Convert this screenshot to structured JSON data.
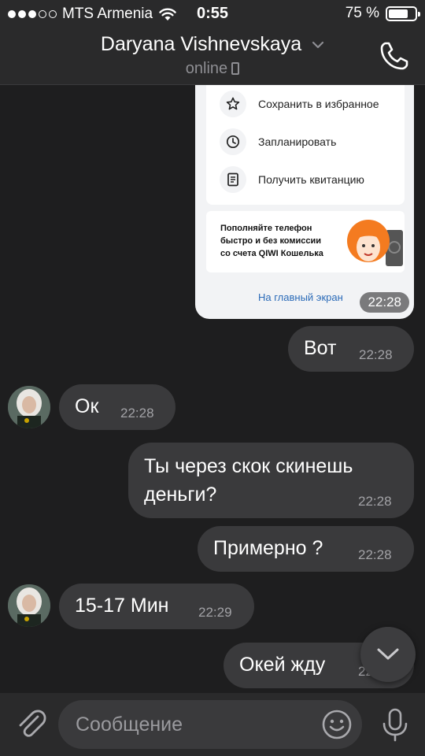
{
  "status_bar": {
    "carrier": "MTS Armenia",
    "time": "0:55",
    "battery_percent": "75 %",
    "battery_level": 0.75,
    "signal_bars": 3,
    "signal_total": 5
  },
  "header": {
    "contact_name": "Daryana Vishnevskaya",
    "status": "online"
  },
  "shared_image": {
    "menu_items": [
      {
        "label": "Сохранить в избранное",
        "icon": "star-icon"
      },
      {
        "label": "Запланировать",
        "icon": "clock-icon"
      },
      {
        "label": "Получить квитанцию",
        "icon": "receipt-icon"
      }
    ],
    "promo_lines": [
      "Пополняйте телефон",
      "быстро и без комиссии",
      "со счета QIWI Кошелька"
    ],
    "home_link": "На главный экран",
    "time": "22:28"
  },
  "messages": [
    {
      "text": "Вот",
      "time": "22:28",
      "direction": "out"
    },
    {
      "text": "Ок",
      "time": "22:28",
      "direction": "in"
    },
    {
      "line1": "Ты через скок скинешь",
      "line2": "деньги?",
      "time": "22:28",
      "direction": "out"
    },
    {
      "text": "Примерно ?",
      "time": "22:28",
      "direction": "out"
    },
    {
      "text": "15-17 Мин",
      "time": "22:29",
      "direction": "in"
    },
    {
      "text": "Окей жду",
      "time": "22:29",
      "direction": "out"
    }
  ],
  "composer": {
    "placeholder": "Сообщение"
  },
  "colors": {
    "background": "#1e1e1f",
    "bar": "#2a2a2b",
    "bubble": "#3a3a3c",
    "link": "#2b6bb8",
    "promo_accent": "#f47b20"
  }
}
